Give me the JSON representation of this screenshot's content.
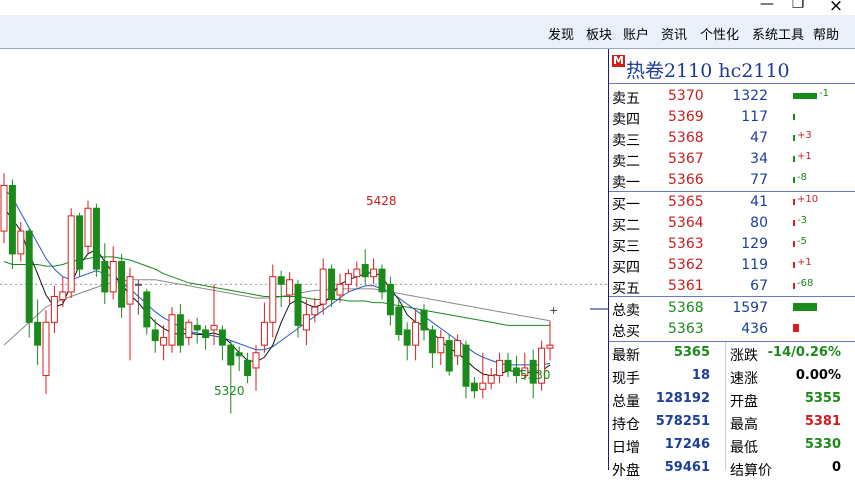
{
  "window": {
    "restore_glyph": "❐",
    "close_glyph": "×"
  },
  "menu": [
    "发现",
    "板块",
    "账户",
    "资讯",
    "个性化",
    "系统工具",
    "帮助"
  ],
  "quote": {
    "badge": "M",
    "title": "热卷2110  hc2110",
    "sell_levels": [
      {
        "label": "卖五",
        "price": "5370",
        "volume": "1322",
        "change": "-1"
      },
      {
        "label": "卖四",
        "price": "5369",
        "volume": "117",
        "change": ""
      },
      {
        "label": "卖三",
        "price": "5368",
        "volume": "47",
        "change": "+3"
      },
      {
        "label": "卖二",
        "price": "5367",
        "volume": "34",
        "change": "+1"
      },
      {
        "label": "卖一",
        "price": "5366",
        "volume": "77",
        "change": "-8"
      }
    ],
    "buy_levels": [
      {
        "label": "买一",
        "price": "5365",
        "volume": "41",
        "change": "+10"
      },
      {
        "label": "买二",
        "price": "5364",
        "volume": "80",
        "change": "-3"
      },
      {
        "label": "买三",
        "price": "5363",
        "volume": "129",
        "change": "-5"
      },
      {
        "label": "买四",
        "price": "5362",
        "volume": "119",
        "change": "+1"
      },
      {
        "label": "买五",
        "price": "5361",
        "volume": "67",
        "change": "-68"
      }
    ],
    "total_sell": {
      "label": "总卖",
      "price": "5368",
      "volume": "1597"
    },
    "total_buy": {
      "label": "总买",
      "price": "5363",
      "volume": "436"
    },
    "stats": [
      {
        "l1": "最新",
        "v1": "5365",
        "l2": "涨跌",
        "v2": "-14/0.26%"
      },
      {
        "l1": "现手",
        "v1": "18",
        "l2": "速涨",
        "v2": "0.00%"
      },
      {
        "l1": "总量",
        "v1": "128192",
        "l2": "开盘",
        "v2": "5355"
      },
      {
        "l1": "持仓",
        "v1": "578251",
        "l2": "最高",
        "v2": "5381"
      },
      {
        "l1": "日增",
        "v1": "17246",
        "l2": "最低",
        "v2": "5330"
      },
      {
        "l1": "外盘",
        "v1": "59461",
        "l2": "结算价",
        "v2": "0"
      }
    ]
  },
  "chart_data": {
    "type": "candlestick",
    "annotations": {
      "high": "5428",
      "low1": "5320",
      "low2": "5330"
    },
    "ylim": [
      5300,
      5540
    ],
    "dashed_level": 5405,
    "up_color": "#d81e1e",
    "down_color": "#1a8a1a",
    "candles": [
      {
        "o": 5440,
        "c": 5470,
        "h": 5478,
        "l": 5432
      },
      {
        "o": 5470,
        "c": 5425,
        "h": 5474,
        "l": 5415
      },
      {
        "o": 5425,
        "c": 5440,
        "h": 5446,
        "l": 5420
      },
      {
        "o": 5440,
        "c": 5380,
        "h": 5442,
        "l": 5370
      },
      {
        "o": 5380,
        "c": 5365,
        "h": 5395,
        "l": 5352
      },
      {
        "o": 5345,
        "c": 5380,
        "h": 5388,
        "l": 5333
      },
      {
        "o": 5380,
        "c": 5397,
        "h": 5404,
        "l": 5373
      },
      {
        "o": 5395,
        "c": 5400,
        "h": 5410,
        "l": 5390
      },
      {
        "o": 5400,
        "c": 5450,
        "h": 5455,
        "l": 5396
      },
      {
        "o": 5450,
        "c": 5415,
        "h": 5452,
        "l": 5410
      },
      {
        "o": 5430,
        "c": 5455,
        "h": 5460,
        "l": 5425
      },
      {
        "o": 5455,
        "c": 5415,
        "h": 5458,
        "l": 5410
      },
      {
        "o": 5420,
        "c": 5400,
        "h": 5432,
        "l": 5392
      },
      {
        "o": 5400,
        "c": 5420,
        "h": 5430,
        "l": 5395
      },
      {
        "o": 5420,
        "c": 5390,
        "h": 5425,
        "l": 5383
      },
      {
        "o": 5392,
        "c": 5410,
        "h": 5416,
        "l": 5355
      },
      {
        "o": 5405,
        "c": 5405,
        "h": 5408,
        "l": 5385
      },
      {
        "o": 5400,
        "c": 5377,
        "h": 5402,
        "l": 5372
      },
      {
        "o": 5375,
        "c": 5368,
        "h": 5382,
        "l": 5360
      },
      {
        "o": 5365,
        "c": 5370,
        "h": 5378,
        "l": 5355
      },
      {
        "o": 5365,
        "c": 5385,
        "h": 5390,
        "l": 5360
      },
      {
        "o": 5385,
        "c": 5365,
        "h": 5392,
        "l": 5360
      },
      {
        "o": 5370,
        "c": 5380,
        "h": 5382,
        "l": 5365
      },
      {
        "o": 5378,
        "c": 5375,
        "h": 5383,
        "l": 5366
      },
      {
        "o": 5375,
        "c": 5370,
        "h": 5378,
        "l": 5362
      },
      {
        "o": 5375,
        "c": 5378,
        "h": 5405,
        "l": 5365
      },
      {
        "o": 5375,
        "c": 5365,
        "h": 5378,
        "l": 5355
      },
      {
        "o": 5365,
        "c": 5352,
        "h": 5368,
        "l": 5320
      },
      {
        "o": 5360,
        "c": 5358,
        "h": 5364,
        "l": 5348
      },
      {
        "o": 5355,
        "c": 5345,
        "h": 5360,
        "l": 5340
      },
      {
        "o": 5350,
        "c": 5360,
        "h": 5365,
        "l": 5335
      },
      {
        "o": 5365,
        "c": 5380,
        "h": 5393,
        "l": 5360
      },
      {
        "o": 5380,
        "c": 5410,
        "h": 5418,
        "l": 5370
      },
      {
        "o": 5410,
        "c": 5405,
        "h": 5414,
        "l": 5390
      },
      {
        "o": 5398,
        "c": 5408,
        "h": 5413,
        "l": 5392
      },
      {
        "o": 5405,
        "c": 5378,
        "h": 5408,
        "l": 5370
      },
      {
        "o": 5375,
        "c": 5385,
        "h": 5395,
        "l": 5365
      },
      {
        "o": 5385,
        "c": 5390,
        "h": 5396,
        "l": 5380
      },
      {
        "o": 5392,
        "c": 5415,
        "h": 5422,
        "l": 5385
      },
      {
        "o": 5415,
        "c": 5395,
        "h": 5418,
        "l": 5390
      },
      {
        "o": 5398,
        "c": 5405,
        "h": 5412,
        "l": 5393
      },
      {
        "o": 5405,
        "c": 5412,
        "h": 5415,
        "l": 5400
      },
      {
        "o": 5410,
        "c": 5415,
        "h": 5420,
        "l": 5403
      },
      {
        "o": 5418,
        "c": 5410,
        "h": 5428,
        "l": 5405
      },
      {
        "o": 5410,
        "c": 5415,
        "h": 5422,
        "l": 5405
      },
      {
        "o": 5415,
        "c": 5400,
        "h": 5418,
        "l": 5395
      },
      {
        "o": 5405,
        "c": 5385,
        "h": 5410,
        "l": 5378
      },
      {
        "o": 5390,
        "c": 5372,
        "h": 5395,
        "l": 5368
      },
      {
        "o": 5375,
        "c": 5365,
        "h": 5380,
        "l": 5355
      },
      {
        "o": 5365,
        "c": 5380,
        "h": 5388,
        "l": 5355
      },
      {
        "o": 5388,
        "c": 5375,
        "h": 5392,
        "l": 5368
      },
      {
        "o": 5375,
        "c": 5360,
        "h": 5378,
        "l": 5350
      },
      {
        "o": 5360,
        "c": 5370,
        "h": 5375,
        "l": 5352
      },
      {
        "o": 5368,
        "c": 5348,
        "h": 5372,
        "l": 5345
      },
      {
        "o": 5358,
        "c": 5368,
        "h": 5372,
        "l": 5352
      },
      {
        "o": 5365,
        "c": 5338,
        "h": 5368,
        "l": 5330
      },
      {
        "o": 5340,
        "c": 5335,
        "h": 5344,
        "l": 5330
      },
      {
        "o": 5336,
        "c": 5340,
        "h": 5360,
        "l": 5330
      },
      {
        "o": 5340,
        "c": 5345,
        "h": 5350,
        "l": 5336
      },
      {
        "o": 5345,
        "c": 5355,
        "h": 5360,
        "l": 5340
      },
      {
        "o": 5355,
        "c": 5348,
        "h": 5360,
        "l": 5344
      },
      {
        "o": 5350,
        "c": 5345,
        "h": 5358,
        "l": 5340
      },
      {
        "o": 5345,
        "c": 5350,
        "h": 5360,
        "l": 5342
      },
      {
        "o": 5355,
        "c": 5340,
        "h": 5362,
        "l": 5330
      },
      {
        "o": 5340,
        "c": 5363,
        "h": 5368,
        "l": 5335
      },
      {
        "o": 5363,
        "c": 5365,
        "h": 5381,
        "l": 5355
      }
    ],
    "ma_fast": [
      5455,
      5448,
      5440,
      5425,
      5412,
      5398,
      5390,
      5392,
      5405,
      5418,
      5425,
      5428,
      5420,
      5412,
      5405,
      5398,
      5393,
      5386,
      5380,
      5376,
      5373,
      5372,
      5373,
      5372,
      5372,
      5373,
      5371,
      5366,
      5360,
      5355,
      5354,
      5357,
      5365,
      5380,
      5392,
      5395,
      5392,
      5390,
      5392,
      5398,
      5405,
      5408,
      5410,
      5412,
      5413,
      5410,
      5402,
      5395,
      5385,
      5380,
      5378,
      5373,
      5368,
      5363,
      5360,
      5355,
      5350,
      5346,
      5345,
      5346,
      5348,
      5348,
      5348,
      5346,
      5348,
      5352
    ],
    "ma_mid": [
      5468,
      5462,
      5452,
      5442,
      5432,
      5422,
      5415,
      5410,
      5408,
      5410,
      5412,
      5414,
      5412,
      5410,
      5406,
      5402,
      5397,
      5392,
      5387,
      5383,
      5380,
      5377,
      5374,
      5373,
      5372,
      5371,
      5370,
      5368,
      5366,
      5364,
      5362,
      5362,
      5364,
      5368,
      5372,
      5376,
      5380,
      5384,
      5388,
      5392,
      5396,
      5400,
      5402,
      5404,
      5404,
      5402,
      5400,
      5396,
      5392,
      5388,
      5384,
      5380,
      5376,
      5372,
      5368,
      5364,
      5360,
      5357,
      5355,
      5353,
      5352,
      5352,
      5352,
      5352,
      5352,
      5353
    ],
    "ma_slow": [
      5420,
      5418,
      5418,
      5418,
      5418,
      5417,
      5417,
      5418,
      5420,
      5421,
      5422,
      5423,
      5423,
      5423,
      5422,
      5421,
      5419,
      5417,
      5415,
      5412,
      5410,
      5408,
      5406,
      5405,
      5404,
      5403,
      5402,
      5401,
      5400,
      5399,
      5398,
      5397,
      5397,
      5397,
      5397,
      5397,
      5396,
      5395,
      5395,
      5395,
      5395,
      5394,
      5394,
      5394,
      5393,
      5393,
      5392,
      5391,
      5390,
      5389,
      5388,
      5387,
      5386,
      5385,
      5384,
      5383,
      5382,
      5381,
      5380,
      5379,
      5378,
      5378,
      5378,
      5378,
      5378,
      5378
    ],
    "ma_long": [
      5365,
      5370,
      5375,
      5380,
      5385,
      5390,
      5393,
      5395,
      5397,
      5399,
      5401,
      5403,
      5405,
      5406,
      5407,
      5408,
      5408,
      5408,
      5408,
      5407,
      5406,
      5405,
      5404,
      5403,
      5402,
      5401,
      5400,
      5399,
      5398,
      5397,
      5396,
      5396,
      5396,
      5397,
      5398,
      5399,
      5400,
      5401,
      5401,
      5402,
      5402,
      5402,
      5402,
      5402,
      5402,
      5401,
      5400,
      5399,
      5398,
      5397,
      5396,
      5395,
      5394,
      5393,
      5392,
      5391,
      5390,
      5389,
      5388,
      5387,
      5386,
      5385,
      5384,
      5383,
      5382,
      5381
    ]
  }
}
